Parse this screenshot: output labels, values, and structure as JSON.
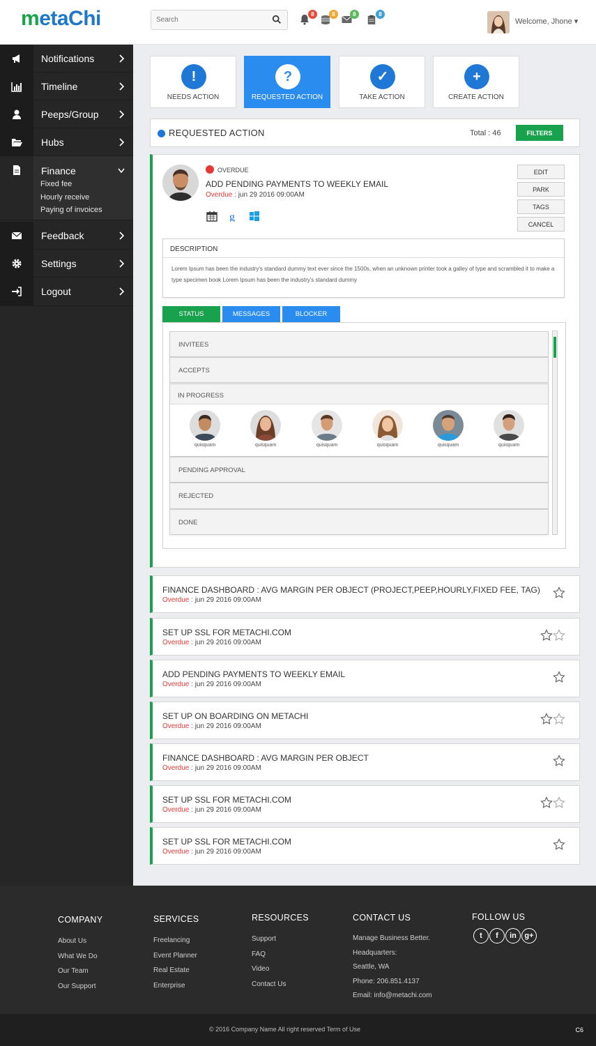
{
  "header": {
    "logo": "metaChi",
    "search_placeholder": "Search",
    "badges": [
      {
        "icon": "bell-icon",
        "count": "8",
        "color": "#e74c3c"
      },
      {
        "icon": "coins-icon",
        "count": "8",
        "color": "#f0a830"
      },
      {
        "icon": "mail-icon",
        "count": "8",
        "color": "#5cb85c"
      },
      {
        "icon": "clipboard-icon",
        "count": "8",
        "color": "#3fa0d8"
      }
    ],
    "welcome": "Welcome, Jhone ▾"
  },
  "sidebar": {
    "items": [
      {
        "label": "Notifications",
        "icon": "megaphone-icon"
      },
      {
        "label": "Timeline",
        "icon": "bar-chart-icon"
      },
      {
        "label": "Peeps/Group",
        "icon": "user-icon"
      },
      {
        "label": "Hubs",
        "icon": "folder-open-icon"
      },
      {
        "label": "Finance",
        "icon": "document-icon",
        "sub": [
          "Fixed fee",
          "Hourly receive",
          "Paying of invoices"
        ]
      },
      {
        "label": "Feedback",
        "icon": "envelope-icon"
      },
      {
        "label": "Settings",
        "icon": "gear-icon"
      },
      {
        "label": "Logout",
        "icon": "sign-in-icon"
      }
    ]
  },
  "actions": [
    {
      "label": "NEEDS ACTION",
      "symbol": "!"
    },
    {
      "label": "REQUESTED ACTION",
      "symbol": "?"
    },
    {
      "label": "TAKE ACTION",
      "symbol": "✓"
    },
    {
      "label": "CREATE ACTION",
      "symbol": "+"
    }
  ],
  "titlebar": {
    "title": "REQUESTED ACTION",
    "total": "Total : 46",
    "filters": "FILTERS"
  },
  "detail": {
    "tag": "OVERDUE",
    "title": "ADD PENDING PAYMENTS TO WEEKLY EMAIL",
    "date_prefix": "Overdue :",
    "date": " jun 29 2016 09:00AM",
    "buttons": [
      "EDIT",
      "PARK",
      "TAGS",
      "CANCEL"
    ],
    "description_header": "DESCRIPTION",
    "description": "Lorem Ipsum has been the industry's standard dummy text ever since the 1500s, when an unknown printer took a galley of type and scrambled it to make a type specimen book Lorem Ipsum has been the industry's standard dummy",
    "tabs": [
      "STATUS",
      "MESSAGES",
      "BLOCKER"
    ],
    "rows": {
      "invitees": "INVITEES",
      "accepts": "ACCEPTS",
      "in_progress": "IN PROGRESS",
      "pending": "PENDING APPROVAL",
      "rejected": "REJECTED",
      "done": "DONE"
    },
    "people": [
      "quisquam",
      "quisquam",
      "quisquam",
      "quisquam",
      "quisquam",
      "quisquam"
    ]
  },
  "list": [
    {
      "title": "FINANCE DASHBOARD : AVG MARGIN PER OBJECT (PROJECT,PEEP,HOURLY,FIXED FEE, TAG)",
      "od": "Overdue :",
      "date": " jun 29 2016 09:00AM",
      "stars": 1
    },
    {
      "title": "SET UP SSL FOR METACHI.COM",
      "od": "Overdue :",
      "date": " jun 29 2016 09:00AM",
      "stars": 2
    },
    {
      "title": "ADD PENDING PAYMENTS TO WEEKLY EMAIL",
      "od": "Overdue :",
      "date": " jun 29 2016 09:00AM",
      "stars": 1
    },
    {
      "title": "SET UP ON BOARDING ON METACHI",
      "od": "Overdue :",
      "date": " jun 29 2016 09:00AM",
      "stars": 2
    },
    {
      "title": "FINANCE DASHBOARD : AVG MARGIN PER OBJECT",
      "od": "Overdue :",
      "date": " jun 29 2016 09:00AM",
      "stars": 1
    },
    {
      "title": "SET UP SSL FOR METACHI.COM",
      "od": "Overdue :",
      "date": " jun 29 2016 09:00AM",
      "stars": 2
    },
    {
      "title": "SET UP SSL FOR METACHI.COM",
      "od": "Overdue :",
      "date": " jun 29 2016 09:00AM",
      "stars": 1
    }
  ],
  "footer": {
    "company": {
      "title": "COMPANY",
      "links": [
        "About Us",
        "What We Do",
        "Our Team",
        "Our Support"
      ]
    },
    "services": {
      "title": "SERVICES",
      "links": [
        "Freelancing",
        "Event Planner",
        "Real Estate",
        "Enterprise"
      ]
    },
    "resources": {
      "title": "RESOURCES",
      "links": [
        "Support",
        "FAQ",
        "Video",
        "Contact Us"
      ]
    },
    "contact": {
      "title": "CONTACT US",
      "links": [
        "Manage Business Better.",
        "Headquarters:",
        "Seattle, WA",
        "Phone: 206.851.4137",
        "Email: info@metachi.com"
      ]
    },
    "follow": {
      "title": "FOLLOW US",
      "icons": [
        "twitter-icon",
        "facebook-icon",
        "linkedin-icon",
        "google-plus-icon"
      ]
    },
    "copyright": "© 2016 Company Name  All right reserved  Term of Use",
    "code": "C6"
  }
}
